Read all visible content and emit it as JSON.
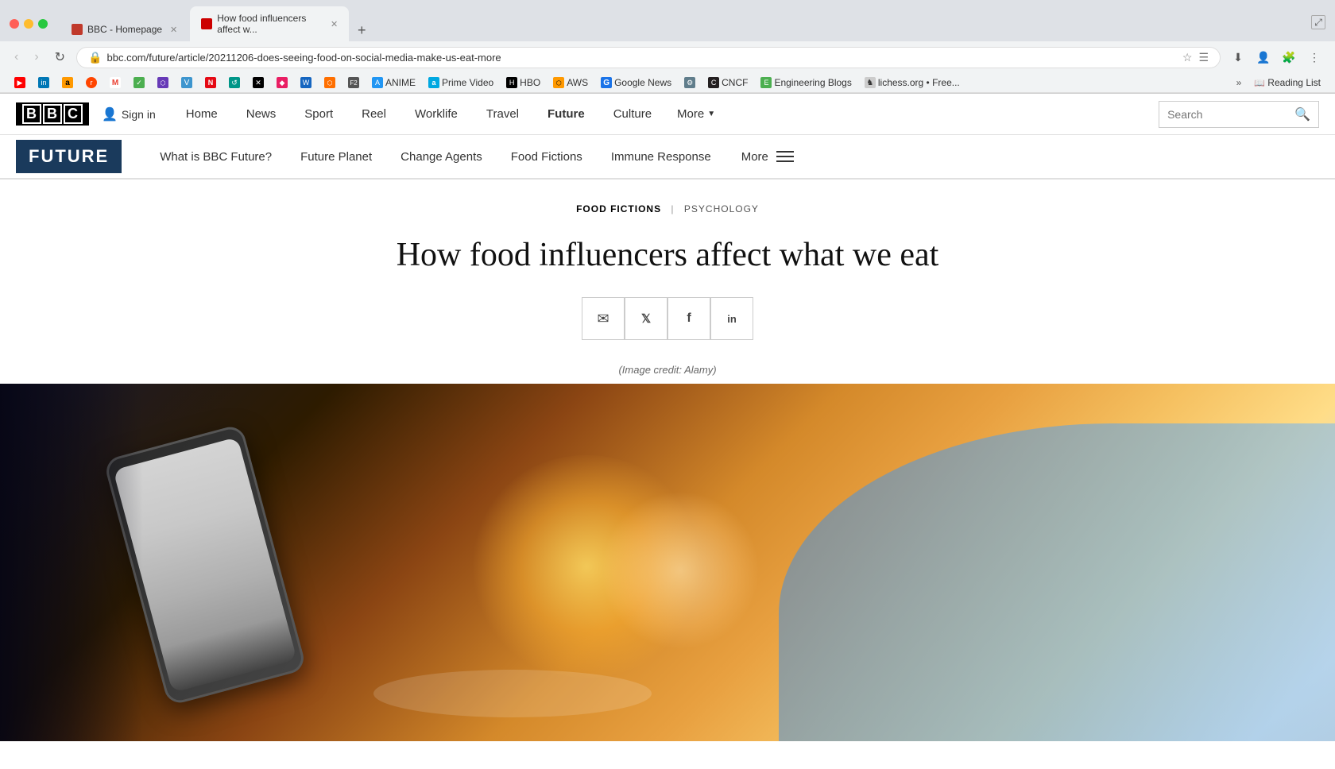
{
  "browser": {
    "tabs": [
      {
        "id": "tab1",
        "title": "BBC - Homepage",
        "active": false,
        "favicon_bg": "#c0392b"
      },
      {
        "id": "tab2",
        "title": "How food influencers affect w...",
        "active": true,
        "favicon_bg": "#cc0000"
      }
    ],
    "address": "bbc.com/future/article/20211206-does-seeing-food-on-social-media-make-us-eat-more",
    "new_tab_label": "+"
  },
  "bookmarks": [
    {
      "label": "",
      "icon": "▶"
    },
    {
      "label": "",
      "icon": "in"
    },
    {
      "label": "a",
      "icon": "a"
    },
    {
      "label": "",
      "icon": "r"
    },
    {
      "label": "M",
      "icon": "M"
    },
    {
      "label": "",
      "icon": "✓"
    },
    {
      "label": "",
      "icon": "⬡"
    },
    {
      "label": "V",
      "icon": "V"
    },
    {
      "label": "N",
      "icon": "N"
    },
    {
      "label": "",
      "icon": "↺"
    },
    {
      "label": "",
      "icon": "✕"
    },
    {
      "label": "",
      "icon": "◆"
    },
    {
      "label": "",
      "icon": "W"
    },
    {
      "label": "",
      "icon": "⬡"
    },
    {
      "label": "F2",
      "icon": "F2"
    },
    {
      "label": "ANIME",
      "icon": "A"
    },
    {
      "label": "Prime Video",
      "icon": "a"
    },
    {
      "label": "HBO",
      "icon": "H"
    },
    {
      "label": "AWS",
      "icon": "⬡"
    },
    {
      "label": "Google News",
      "icon": "G"
    },
    {
      "label": "",
      "icon": "⚙"
    },
    {
      "label": "CNCF",
      "icon": "C"
    },
    {
      "label": "Engineering Blogs",
      "icon": "E"
    },
    {
      "label": "lichess.org • Free...",
      "icon": "♞"
    }
  ],
  "bbc_nav": {
    "logo": "BBC",
    "sign_in": "Sign in",
    "items": [
      {
        "label": "Home",
        "active": false
      },
      {
        "label": "News",
        "active": false
      },
      {
        "label": "Sport",
        "active": false
      },
      {
        "label": "Reel",
        "active": false
      },
      {
        "label": "Worklife",
        "active": false
      },
      {
        "label": "Travel",
        "active": false
      },
      {
        "label": "Future",
        "active": true
      },
      {
        "label": "Culture",
        "active": false
      },
      {
        "label": "More",
        "active": false
      }
    ],
    "search_placeholder": "Search"
  },
  "future_nav": {
    "logo": "FUTURE",
    "items": [
      {
        "label": "What is BBC Future?"
      },
      {
        "label": "Future Planet"
      },
      {
        "label": "Change Agents"
      },
      {
        "label": "Food Fictions"
      },
      {
        "label": "Immune Response"
      }
    ],
    "more_label": "More"
  },
  "article": {
    "section": "FOOD FICTIONS",
    "subsection": "PSYCHOLOGY",
    "title": "How food influencers affect what we eat",
    "image_credit": "(Image credit: Alamy)",
    "share_buttons": [
      {
        "icon": "✉",
        "label": "email"
      },
      {
        "icon": "𝕏",
        "label": "twitter"
      },
      {
        "icon": "f",
        "label": "facebook"
      },
      {
        "icon": "in",
        "label": "linkedin"
      }
    ]
  }
}
